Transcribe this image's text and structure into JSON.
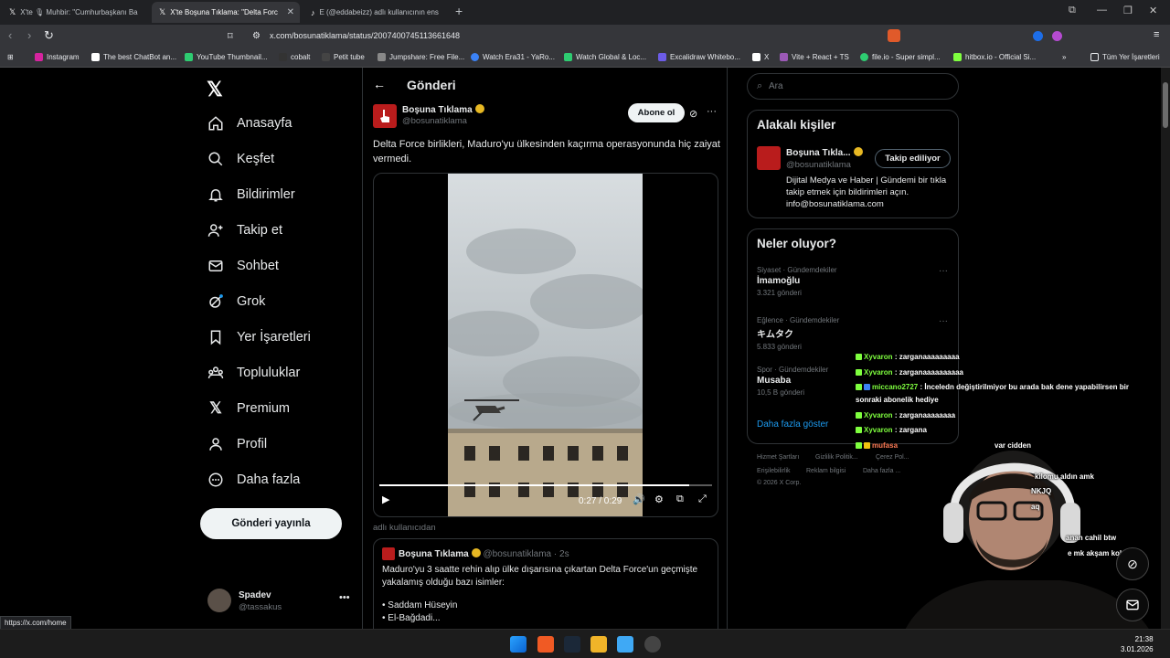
{
  "browser": {
    "tabs": [
      {
        "label": "X'te 🎙 Muhbir: \"Cumhurbaşkanı Ba"
      },
      {
        "label": "X'te Boşuna Tıklama: \"Delta Forc"
      },
      {
        "label": "E (@eddabeizz) adlı kullanıcının ens"
      }
    ],
    "url": "x.com/bosunatiklama/status/2007400745113661648",
    "bookmarks": [
      "Instagram",
      "The best ChatBot an...",
      "YouTube Thumbnail...",
      "cobalt",
      "Petit tube",
      "Jumpshare: Free File...",
      "Watch Era31 - YaRo...",
      "Watch Global & Loc...",
      "Excalidraw Whitebo...",
      "X",
      "Vite + React + TS",
      "file.io - Super simpl...",
      "hitbox.io - Official Si..."
    ],
    "all_bookmarks": "Tüm Yer İşaretleri",
    "status_url": "https://x.com/home"
  },
  "sidebar": {
    "items": [
      {
        "label": "Anasayfa"
      },
      {
        "label": "Keşfet"
      },
      {
        "label": "Bildirimler"
      },
      {
        "label": "Takip et"
      },
      {
        "label": "Sohbet"
      },
      {
        "label": "Grok"
      },
      {
        "label": "Yer İşaretleri"
      },
      {
        "label": "Topluluklar"
      },
      {
        "label": "Premium"
      },
      {
        "label": "Profil"
      },
      {
        "label": "Daha fazla"
      }
    ],
    "post_button": "Gönderi yayınla",
    "user": {
      "name": "Spadev",
      "handle": "@tassakus"
    }
  },
  "main": {
    "header_title": "Gönderi",
    "post": {
      "author": "Boşuna Tıklama",
      "handle": "@bosunatiklama",
      "follow_label": "Abone ol",
      "text": "Delta Force birlikleri, Maduro'yu ülkesinden kaçırma operasyonunda hiç zaiyat vermedi.",
      "video": {
        "time": "0:27 / 0:29",
        "progress": 0.93
      }
    },
    "faint_text": "adlı kullanıcıdan",
    "quote": {
      "author": "Boşuna Tıklama",
      "handle": "@bosunatiklama · 2s",
      "text": "Maduro'yu 3 saatte rehin alıp ülke dışarısına çıkartan Delta Force'un geçmişte yakalamış olduğu bazı isimler:",
      "lines": [
        "• Saddam Hüseyin",
        "• El-Bağdadi..."
      ]
    }
  },
  "right": {
    "search_placeholder": "Ara",
    "related": {
      "title": "Alakalı kişiler",
      "name": "Boşuna Tıkla...",
      "handle": "@bosunatiklama",
      "follow_state": "Takip ediliyor",
      "bio": "Dijital Medya ve Haber | Gündemi bir tıkla takip etmek için bildirimleri açın. info@bosunatiklama.com"
    },
    "trends": {
      "title": "Neler oluyor?",
      "items": [
        {
          "category": "Siyaset · Gündemdekiler",
          "name": "İmamoğlu",
          "count": "3.321 gönderi"
        },
        {
          "category": "Eğlence · Gündemdekiler",
          "name": "キムタク",
          "count": "5.833 gönderi"
        },
        {
          "category": "Spor · Gündemdekiler",
          "name": "Musaba",
          "count": "10,5 B gönderi"
        }
      ],
      "more": "Daha fazla göster"
    },
    "footer": [
      "Hizmet Şartları",
      "Gizlilik Politik...",
      "Çerez Pol...",
      "Erişilebilirlik",
      "Reklam bilgisi",
      "Daha fazla ...",
      "© 2026 X Corp."
    ]
  },
  "chat": [
    {
      "user": "Xyvaron",
      "msg": ": zarganaaaaaaaaa"
    },
    {
      "user": "Xyvaron",
      "msg": ": zarganaaaaaaaaaa"
    },
    {
      "user": "miccano2727",
      "msg": ": İnceledn değiştirilmiyor bu arada bak dene yapabilirsen bir"
    },
    {
      "user": "",
      "msg": "sonraki abonelik hediye"
    },
    {
      "user": "Xyvaron",
      "msg": ": zarganaaaaaaaa"
    },
    {
      "user": "Xyvaron",
      "msg": ": zargana"
    },
    {
      "user": "mufasa",
      "msg": "var cidden"
    },
    {
      "user": "",
      "msg": "kilomu aldın amk"
    },
    {
      "user": "",
      "msg": "NKJQ"
    },
    {
      "user": "",
      "msg": "aq"
    },
    {
      "user": "",
      "msg": "anan cahil btw"
    },
    {
      "user": "",
      "msg": "e mk akşam kola cips"
    }
  ],
  "taskbar": {
    "time": "21:38",
    "date": "3.01.2026"
  },
  "colors": {
    "accent": "#1d9bf0",
    "verified": "#e7b823",
    "brand_red": "#b91c1c"
  }
}
